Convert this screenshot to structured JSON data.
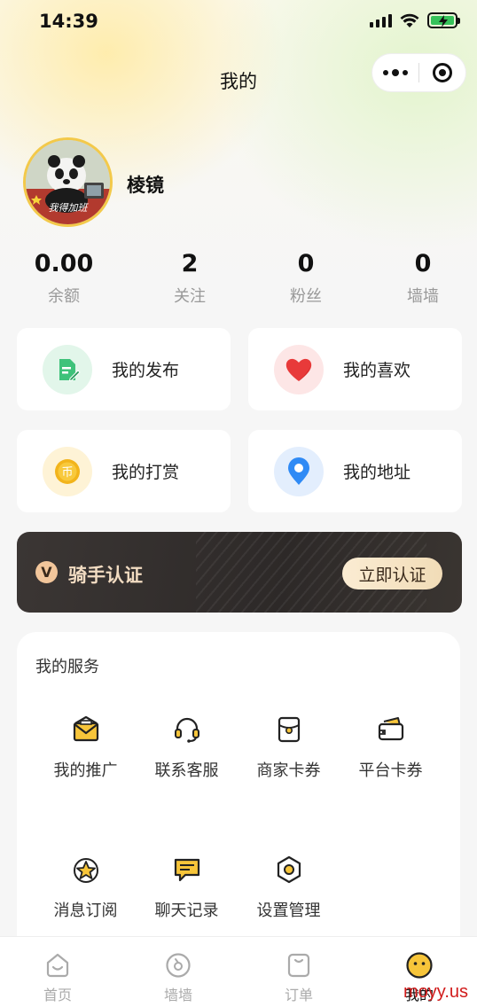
{
  "status_bar": {
    "time": "14:39"
  },
  "nav": {
    "title": "我的"
  },
  "profile": {
    "name": "棱镜",
    "avatar_caption": "我得加班"
  },
  "stats": [
    {
      "value": "0.00",
      "label": "余额"
    },
    {
      "value": "2",
      "label": "关注"
    },
    {
      "value": "0",
      "label": "粉丝"
    },
    {
      "value": "0",
      "label": "墙墙"
    }
  ],
  "quick_cards": [
    {
      "label": "我的发布",
      "icon": "document-edit-icon",
      "color": "#3ec27a"
    },
    {
      "label": "我的喜欢",
      "icon": "heart-icon",
      "color": "#e83a3a"
    },
    {
      "label": "我的打赏",
      "icon": "coin-icon",
      "color": "#f2b41b"
    },
    {
      "label": "我的地址",
      "icon": "location-pin-icon",
      "color": "#2f8af5"
    }
  ],
  "rider": {
    "badge": "V",
    "title": "骑手认证",
    "button": "立即认证"
  },
  "services": {
    "title": "我的服务",
    "items": [
      {
        "label": "我的推广",
        "icon": "envelope-icon"
      },
      {
        "label": "联系客服",
        "icon": "headset-icon"
      },
      {
        "label": "商家卡券",
        "icon": "coupon-icon"
      },
      {
        "label": "平台卡券",
        "icon": "wallet-card-icon"
      },
      {
        "label": "消息订阅",
        "icon": "star-icon"
      },
      {
        "label": "聊天记录",
        "icon": "chat-icon"
      },
      {
        "label": "设置管理",
        "icon": "settings-icon"
      }
    ]
  },
  "tabbar": [
    {
      "label": "首页",
      "icon": "home-icon",
      "active": false
    },
    {
      "label": "墙墙",
      "icon": "wall-icon",
      "active": false
    },
    {
      "label": "订单",
      "icon": "order-icon",
      "active": false
    },
    {
      "label": "我的",
      "icon": "smiley-icon",
      "active": true
    }
  ],
  "watermark": "moyy.us",
  "colors": {
    "accent": "#f2b41b",
    "banner_bg": "#2f2b2a"
  }
}
